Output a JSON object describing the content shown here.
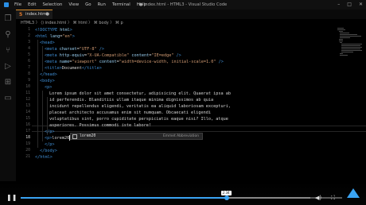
{
  "app": {
    "menu": [
      "File",
      "Edit",
      "Selection",
      "View",
      "Go",
      "Run",
      "Terminal",
      "Help"
    ],
    "window_title": "● index.html - HTML3 - Visual Studio Code",
    "controls": {
      "minimize": "–",
      "maximize": "□",
      "close": "✕"
    }
  },
  "tab": {
    "icon": "5",
    "label": "index.html",
    "close": "●"
  },
  "breadcrumb": "HTML3 〉 ⟨⟩ index.html 〉 ⌘ html 〉 ⌘ body 〉 ⌘ p",
  "gutter": {
    "line_numbers": [
      "1",
      "2",
      "3",
      "4",
      "5",
      "6",
      "7",
      "8",
      "9",
      "10",
      "11",
      "12",
      "13",
      "14",
      "15",
      "16",
      "17",
      "18",
      "19",
      "20",
      "21"
    ],
    "active_line": "18"
  },
  "code": {
    "l1": {
      "tag": "<!DOCTYPE",
      "word": " html",
      "end": ">"
    },
    "l2": {
      "open": "<html",
      "attr": " lang",
      "eq": "=",
      "val": "\"en\"",
      "end": ">"
    },
    "l3": {
      "text": "<head>"
    },
    "l4": {
      "open": "<meta",
      "attr": " charset",
      "eq": "=",
      "val": "\"UTF-8\"",
      "end": " />"
    },
    "l5": {
      "open": "<meta",
      "attr1": " http-equiv",
      "eq": "=",
      "val1": "\"X-UA-Compatible\"",
      "attr2": " content",
      "val2": "\"IE=edge\"",
      "end": " />"
    },
    "l6": {
      "open": "<meta",
      "attr1": " name",
      "eq": "=",
      "val1": "\"viewport\"",
      "attr2": " content",
      "val2": "\"width=device-width, initial-scale=1.0\"",
      "end": " />"
    },
    "l7": {
      "open": "<title>",
      "text": "Document",
      "close": "</title>"
    },
    "l8": {
      "text": "</head>"
    },
    "l9": {
      "text": "<body>"
    },
    "l10": {
      "text": "<p>"
    },
    "l11": {
      "text": "Lorem ipsum dolor sit amet consectetur, adipisicing elit. Quaerat ipsa ab"
    },
    "l12": {
      "text": "id perferendis. Blanditiis ullam itaque minima dignissimos ab quia"
    },
    "l13": {
      "text": "incidunt repellendus eligendi, veritatis ea aliquid laboriosam excepturi,"
    },
    "l14": {
      "text": "placeat architecto accusamus enim sit numquam. Obcaecati eligendi"
    },
    "l15": {
      "text": "voluptatibus sint, porro cupiditate perspiciatis eaque nisi? Illo, atque"
    },
    "l16": {
      "text": "asperiores. Possimus commodi iste labore!"
    },
    "l17": {
      "text": "</p>"
    },
    "l18": {
      "open": "<p>",
      "typed": "lorem20"
    },
    "l19": {
      "text": "</p>"
    },
    "l20": {
      "text": "</body>"
    },
    "l21": {
      "text": "</html>"
    }
  },
  "suggestion": {
    "label": "lorem20",
    "detail": "Emmet Abbreviation"
  },
  "player": {
    "time_tooltip": "2:34",
    "played_fraction": 0.64,
    "buffered_fraction": 0.9,
    "accent": "#3aa3f2"
  },
  "colors": {
    "tag": "#3f8fd6",
    "attribute": "#9bd2f5",
    "string": "#d19a72",
    "tab_accent": "#d68b2a"
  }
}
